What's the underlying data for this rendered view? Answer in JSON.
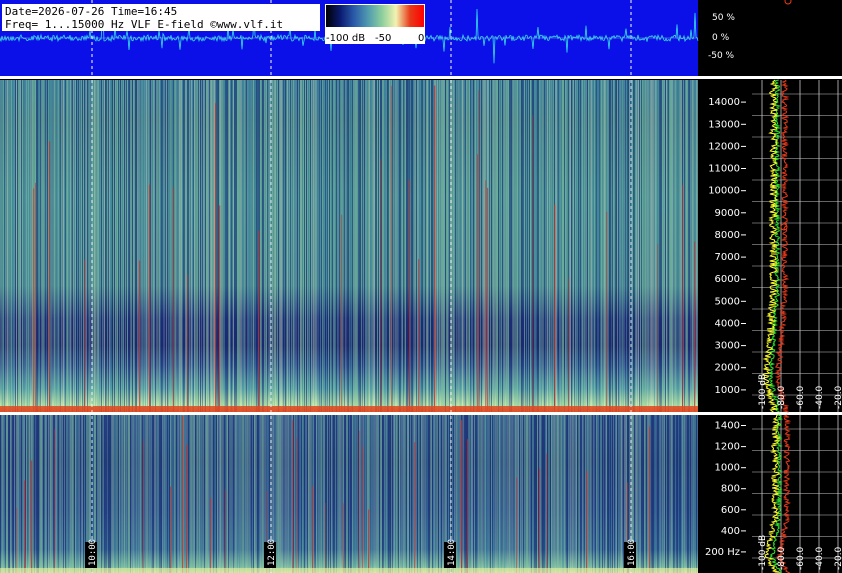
{
  "header": {
    "line1": "Date=2026-07-26 Time=16:45",
    "line2": "Freq= 1...15000 Hz   VLF E-field ©www.vlf.it"
  },
  "colorbar": {
    "labels": [
      "-100 dB",
      "-50",
      "0"
    ],
    "stops": [
      "#000000",
      "#0a1a6e",
      "#2a5aa8",
      "#4f9ab0",
      "#8ccf9c",
      "#f2f2b0",
      "#e83a1a",
      "#ff0000"
    ]
  },
  "colors": {
    "background": "#000000",
    "waveform_panel": "#0b10e8",
    "waveform": "#35e0ea",
    "spectrum_avg": "#ffff30",
    "spectrum_peak": "#2be52b",
    "spectrum_ref": "#e83a1a",
    "grid": "#ffffff"
  },
  "chart_data": [
    {
      "type": "line",
      "name": "waveform",
      "ylabels": [
        "50 %",
        "0 %",
        "-50 %"
      ],
      "ylim": [
        -100,
        100
      ],
      "yticks": [
        50,
        0,
        -50
      ]
    },
    {
      "type": "heatmap",
      "name": "spectrogram-full",
      "ylim": [
        0,
        15000
      ],
      "yticks": [
        1000,
        2000,
        3000,
        4000,
        5000,
        6000,
        7000,
        8000,
        9000,
        10000,
        11000,
        12000,
        13000,
        14000
      ],
      "time_labels": [
        "10:00",
        "12:00",
        "14:00",
        "16:00"
      ]
    },
    {
      "type": "heatmap",
      "name": "spectrogram-low",
      "ylim": [
        0,
        1500
      ],
      "yticks": [
        200,
        400,
        600,
        800,
        1000,
        1200,
        1400
      ],
      "ytick_labels": [
        "200 Hz",
        "400",
        "600",
        "800",
        "1000",
        "1200",
        "1400"
      ]
    },
    {
      "type": "line",
      "name": "spectrum-full",
      "xlabels": [
        "-100 dB",
        "-80.0",
        "-60.0",
        "-40.0",
        "-20.0"
      ],
      "xlim": [
        -100,
        0
      ],
      "ylim": [
        0,
        15000
      ]
    },
    {
      "type": "line",
      "name": "spectrum-low",
      "xlabels": [
        "-100 dB",
        "-80.0",
        "-60.0",
        "-40.0",
        "-20.0"
      ],
      "xlim": [
        -100,
        0
      ],
      "ylim": [
        0,
        1500
      ]
    }
  ]
}
